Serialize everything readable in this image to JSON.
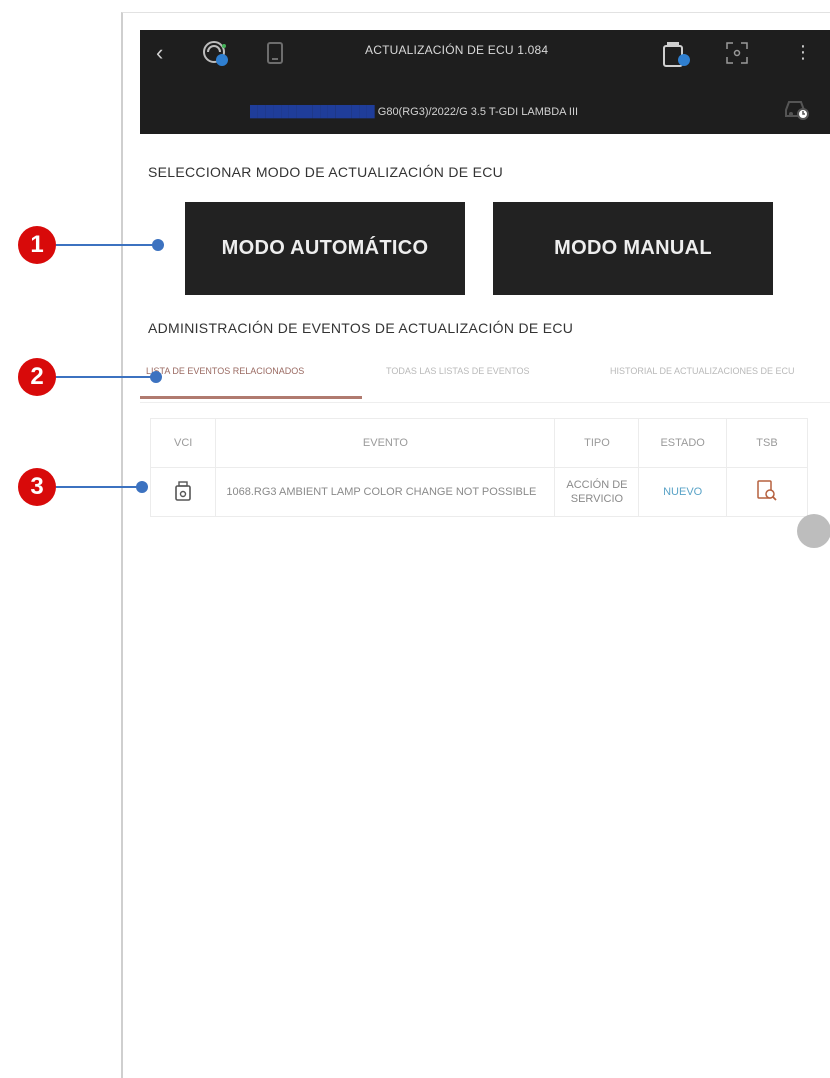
{
  "header": {
    "title": "ACTUALIZACIÓN DE ECU 1.084",
    "vin_hidden": "████████████████",
    "vehicle": "G80(RG3)/2022/G 3.5 T-GDI LAMBDA III"
  },
  "mode_section": {
    "title": "SELECCIONAR MODO DE ACTUALIZACIÓN DE ECU",
    "auto_label": "MODO AUTOMÁTICO",
    "manual_label": "MODO MANUAL"
  },
  "events_section": {
    "title": "ADMINISTRACIÓN DE EVENTOS DE ACTUALIZACIÓN DE ECU",
    "tabs": [
      {
        "label": "LISTA DE EVENTOS RELACIONADOS"
      },
      {
        "label": "TODAS LAS LISTAS DE EVENTOS"
      },
      {
        "label": "HISTORIAL DE ACTUALIZACIONES DE ECU"
      }
    ],
    "columns": [
      "VCI",
      "EVENTO",
      "TIPO",
      "ESTADO",
      "TSB"
    ],
    "rows": [
      {
        "event": "1068.RG3 AMBIENT LAMP COLOR CHANGE NOT POSSIBLE",
        "type": "ACCIÓN DE SERVICIO",
        "status": "NUEVO"
      }
    ]
  },
  "annotations": [
    "1",
    "2",
    "3"
  ],
  "colors": {
    "appbar": "#1e1e1e",
    "button": "#222222",
    "callout_red": "#d80a0a",
    "leader_blue": "#3c72c0",
    "tab_active": "#b07a6f",
    "status_new": "#5aa3c7"
  },
  "icons": [
    "back-arrow-icon",
    "vehicle-gauge-icon",
    "phone-icon",
    "vci-device-icon",
    "scan-icon",
    "more-vert-icon",
    "car-status-icon",
    "vci-icon",
    "tsb-search-icon"
  ]
}
